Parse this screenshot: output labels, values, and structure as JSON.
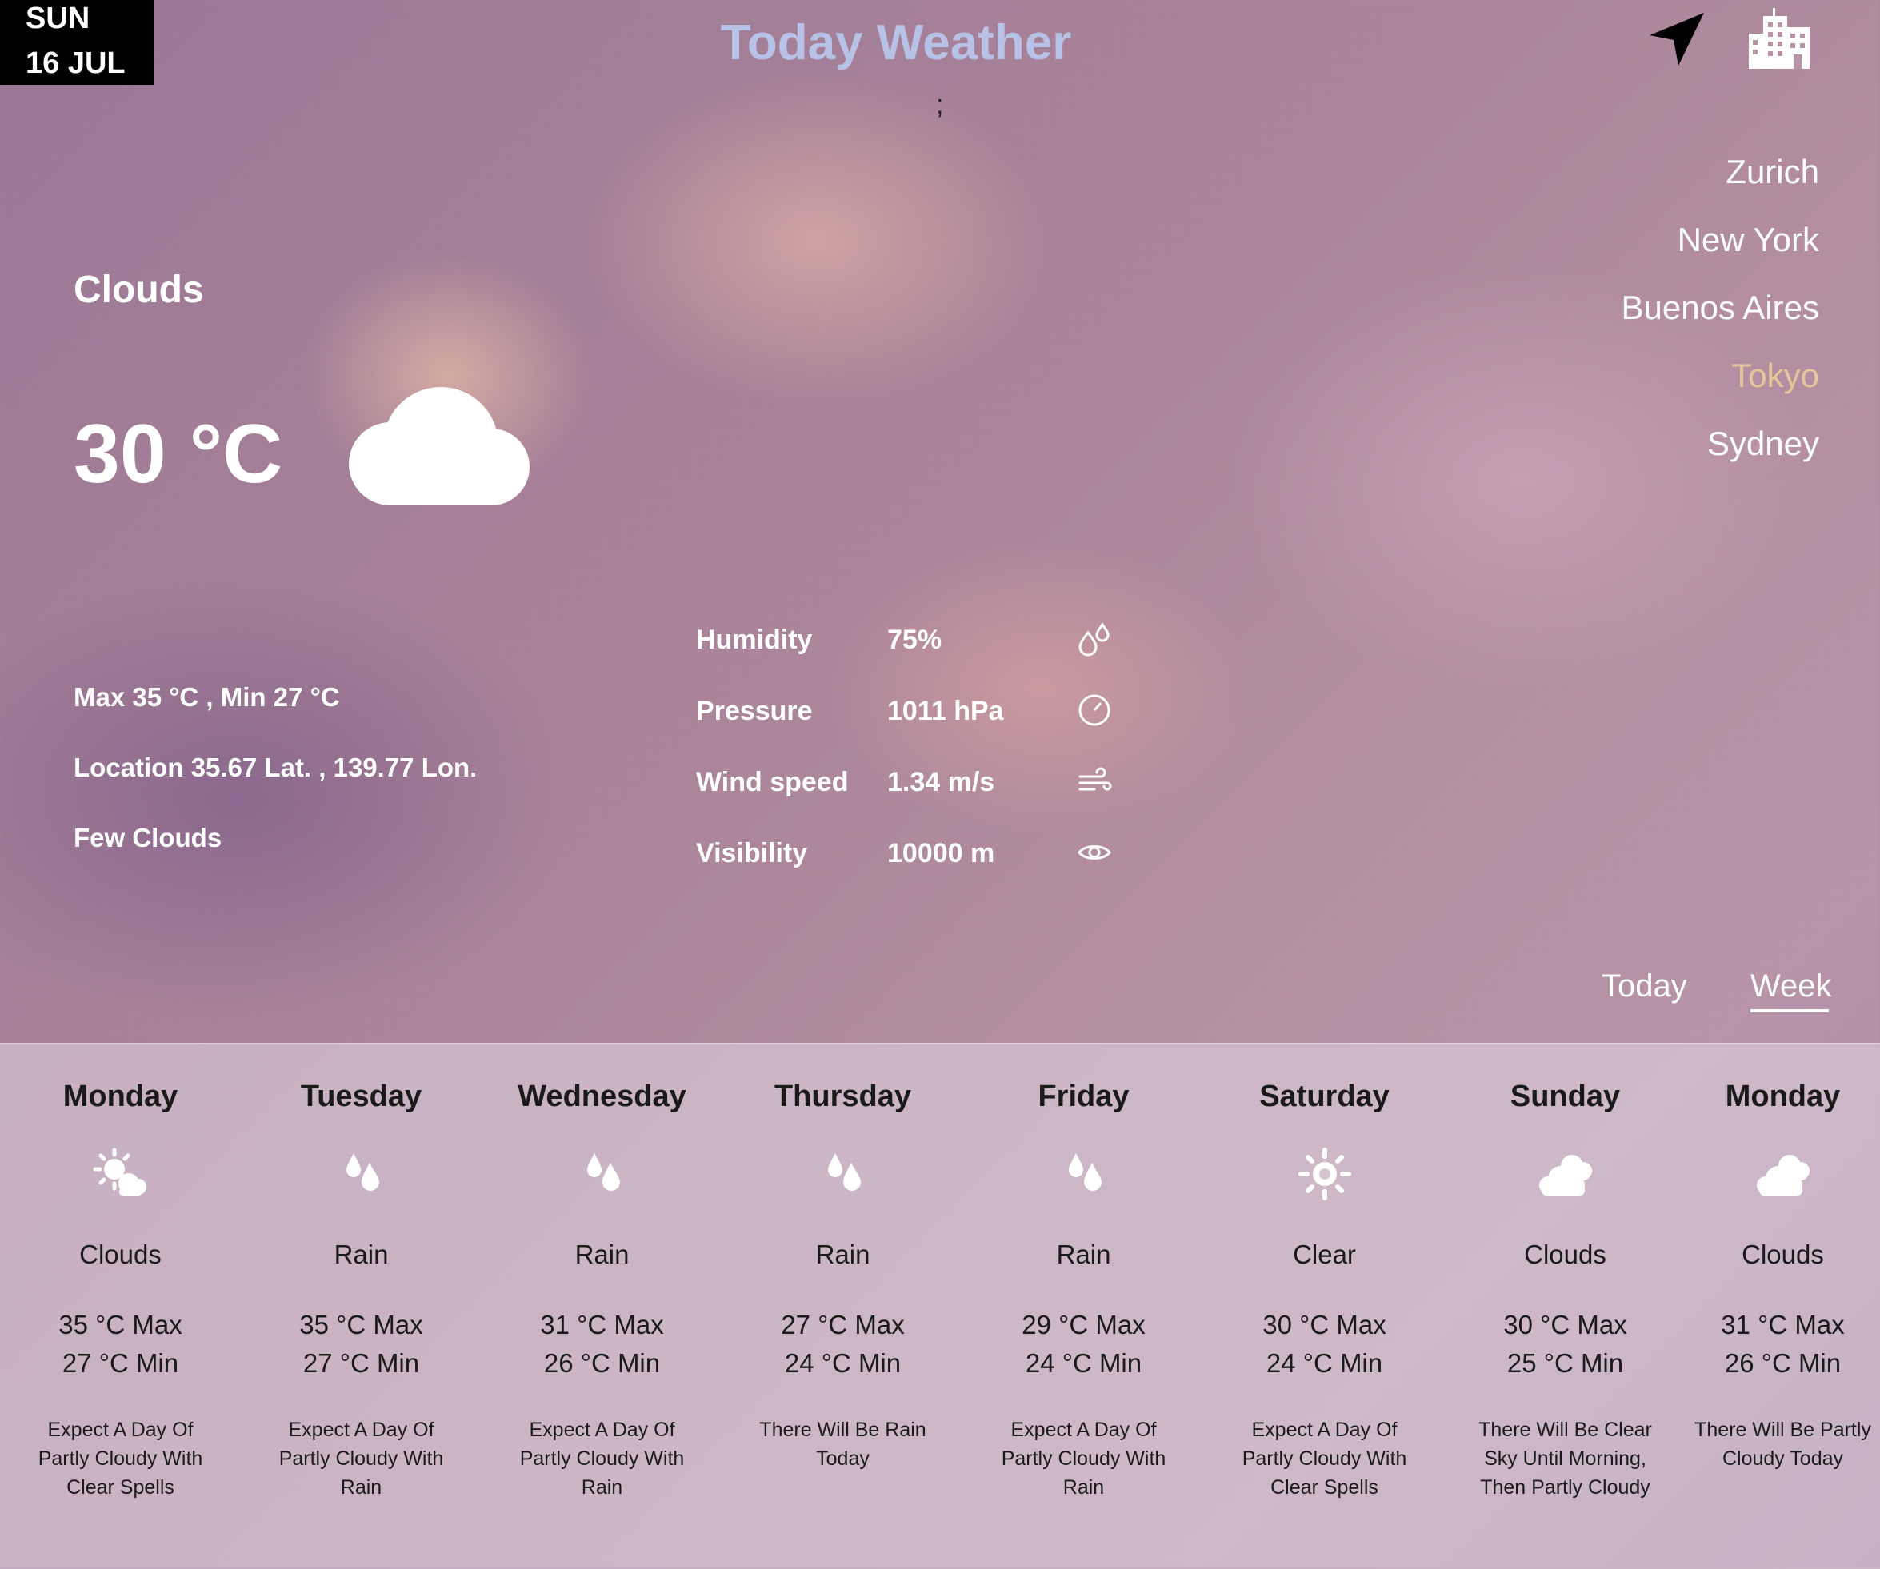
{
  "header": {
    "day_of_week": "SUN",
    "date": "16 JUL",
    "title": "Today Weather",
    "sub_mark": ";",
    "icons": [
      "navigation-arrow-icon",
      "city-buildings-icon"
    ]
  },
  "cities": [
    {
      "name": "Zurich",
      "selected": false
    },
    {
      "name": "New York",
      "selected": false
    },
    {
      "name": "Buenos Aires",
      "selected": false
    },
    {
      "name": "Tokyo",
      "selected": true
    },
    {
      "name": "Sydney",
      "selected": false
    }
  ],
  "current": {
    "condition": "Clouds",
    "temperature": "30 °C",
    "icon": "cloud-icon",
    "max_min": "Max 35 °C , Min 27 °C",
    "location": "Location 35.67 Lat. , 139.77 Lon.",
    "description": "Few Clouds"
  },
  "stats": [
    {
      "label": "Humidity",
      "value": "75%",
      "icon": "humidity-icon"
    },
    {
      "label": "Pressure",
      "value": "1011 hPa",
      "icon": "pressure-gauge-icon"
    },
    {
      "label": "Wind speed",
      "value": "1.34 m/s",
      "icon": "wind-icon"
    },
    {
      "label": "Visibility",
      "value": "10000 m",
      "icon": "eye-icon"
    }
  ],
  "tabs": {
    "today": "Today",
    "week": "Week",
    "active": "week"
  },
  "forecast": [
    {
      "day": "Monday",
      "icon": "sun-cloud-icon",
      "condition": "Clouds",
      "max": "35 °C Max",
      "min": "27 °C Min",
      "desc": "Expect A Day Of Partly Cloudy With Clear Spells"
    },
    {
      "day": "Tuesday",
      "icon": "rain-drops-icon",
      "condition": "Rain",
      "max": "35 °C Max",
      "min": "27 °C Min",
      "desc": "Expect A Day Of Partly Cloudy With Rain"
    },
    {
      "day": "Wednesday",
      "icon": "rain-drops-icon",
      "condition": "Rain",
      "max": "31 °C Max",
      "min": "26 °C Min",
      "desc": "Expect A Day Of Partly Cloudy With Rain"
    },
    {
      "day": "Thursday",
      "icon": "rain-drops-icon",
      "condition": "Rain",
      "max": "27 °C Max",
      "min": "24 °C Min",
      "desc": "There Will Be Rain Today"
    },
    {
      "day": "Friday",
      "icon": "rain-drops-icon",
      "condition": "Rain",
      "max": "29 °C Max",
      "min": "24 °C Min",
      "desc": "Expect A Day Of Partly Cloudy With Rain"
    },
    {
      "day": "Saturday",
      "icon": "sun-icon",
      "condition": "Clear",
      "max": "30 °C Max",
      "min": "24 °C Min",
      "desc": "Expect A Day Of Partly Cloudy With Clear Spells"
    },
    {
      "day": "Sunday",
      "icon": "clouds-icon",
      "condition": "Clouds",
      "max": "30 °C Max",
      "min": "25 °C Min",
      "desc": "There Will Be Clear Sky Until Morning, Then Partly Cloudy"
    },
    {
      "day": "Monday",
      "icon": "clouds-icon",
      "condition": "Clouds",
      "max": "31 °C Max",
      "min": "26 °C Min",
      "desc": "There Will Be Partly Cloudy Today"
    }
  ],
  "colors": {
    "title": "#b8c2e6",
    "selected_city": "#e7c59a",
    "date_badge_bg": "#000000",
    "forecast_text": "#1a1a1a"
  }
}
